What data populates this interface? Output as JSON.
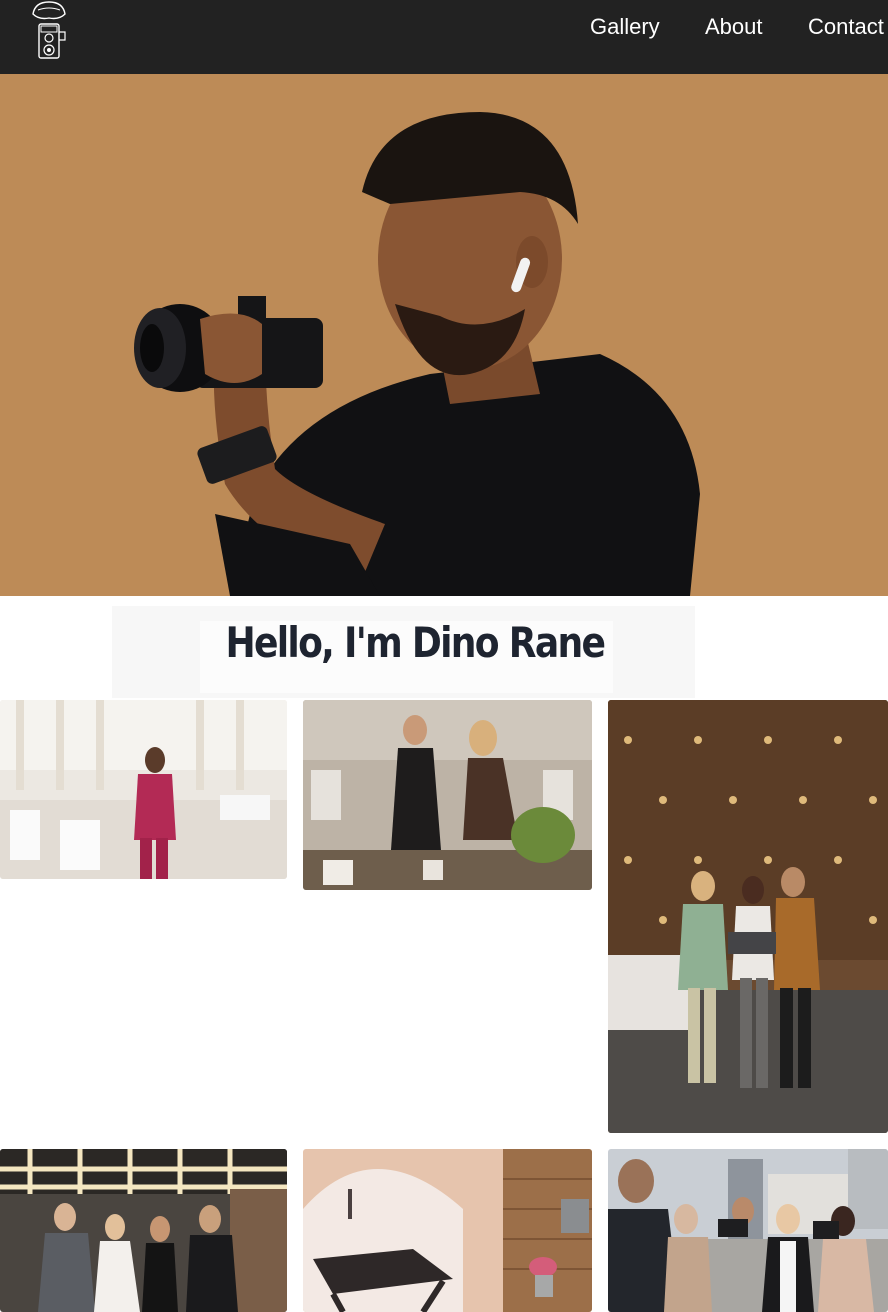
{
  "navbar": {
    "logo_icon": "vintage-camera-logo-icon",
    "links": [
      "Gallery",
      "About",
      "Contact"
    ]
  },
  "hero": {
    "image": "photographer-with-camera-hero-image",
    "background_color": "#c18f5b"
  },
  "intro": {
    "title": "Hello, I'm Dino Rane"
  },
  "gallery": {
    "photos": [
      "woman-in-pink-suit-banquet-hall-photo",
      "event-planners-setting-table-photo",
      "team-with-laptop-wall-lights-photo",
      "wedding-guests-champagne-photo",
      "cafe-interior-lamp-photo",
      "press-photographers-interview-photo"
    ]
  },
  "colors": {
    "navbar_bg": "#222222",
    "nav_text": "#ffffff",
    "title_text": "#1e2430"
  }
}
